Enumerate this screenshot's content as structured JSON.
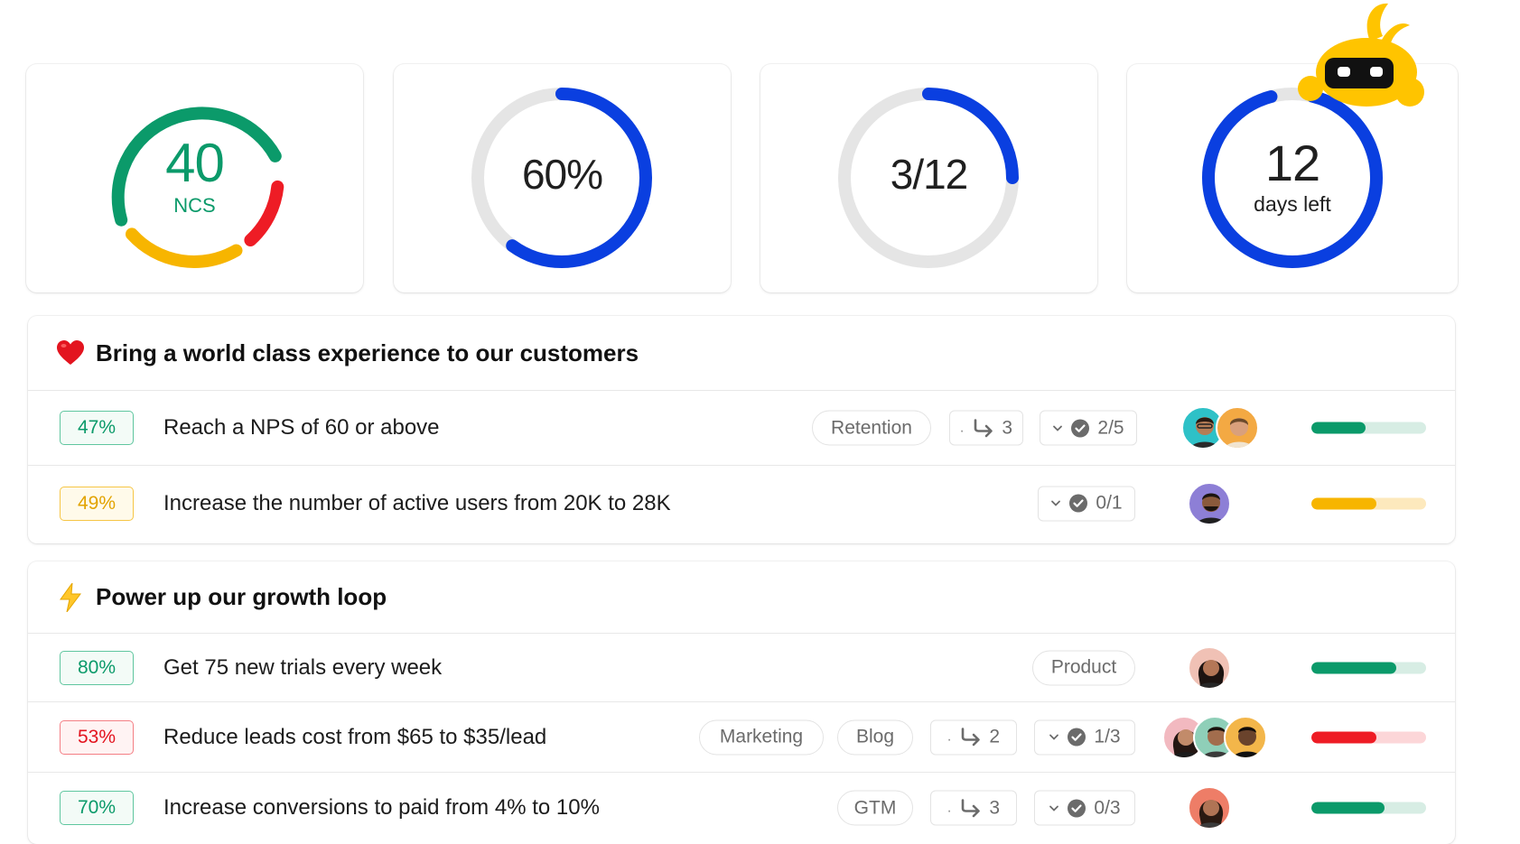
{
  "kpis": [
    {
      "value": "40",
      "label": "NCS",
      "type": "ncs"
    },
    {
      "value": "60%",
      "label": "",
      "progress": 0.6
    },
    {
      "value": "3/12",
      "label": "",
      "progress": 0.25
    },
    {
      "value": "12",
      "label": "days left",
      "progress": 0.92
    }
  ],
  "colors": {
    "accent_blue": "#0a3fe0",
    "green": "#0b9a6a",
    "yellow": "#f7b500",
    "red": "#ee1c25",
    "track": "#e5e5e5",
    "mascot_yellow": "#ffc400"
  },
  "objectives": [
    {
      "icon": "heart-icon",
      "title": "Bring a world class experience to our customers",
      "key_results": [
        {
          "percent": "47%",
          "status": "green",
          "title": "Reach a NPS of 60 or above",
          "tags": [
            "Retention"
          ],
          "subtasks": "3",
          "checks": "2/5",
          "avatars": 2,
          "progress": 0.47
        },
        {
          "percent": "49%",
          "status": "yellow",
          "title": "Increase the number of active users from 20K to 28K",
          "tags": [],
          "subtasks": null,
          "checks": "0/1",
          "avatars": 1,
          "progress": 0.57
        }
      ]
    },
    {
      "icon": "lightning-icon",
      "title": "Power up our growth loop",
      "key_results": [
        {
          "percent": "80%",
          "status": "green",
          "title": "Get 75 new trials every week",
          "tags": [
            "Product"
          ],
          "subtasks": null,
          "checks": null,
          "avatars": 1,
          "progress": 0.74
        },
        {
          "percent": "53%",
          "status": "red",
          "title": "Reduce leads cost from $65 to $35/lead",
          "tags": [
            "Marketing",
            "Blog"
          ],
          "subtasks": "2",
          "checks": "1/3",
          "avatars": 3,
          "progress": 0.57
        },
        {
          "percent": "70%",
          "status": "green",
          "title": "Increase conversions to paid from 4% to 10%",
          "tags": [
            "GTM"
          ],
          "subtasks": "3",
          "checks": "0/3",
          "avatars": 1,
          "progress": 0.64
        }
      ]
    }
  ]
}
